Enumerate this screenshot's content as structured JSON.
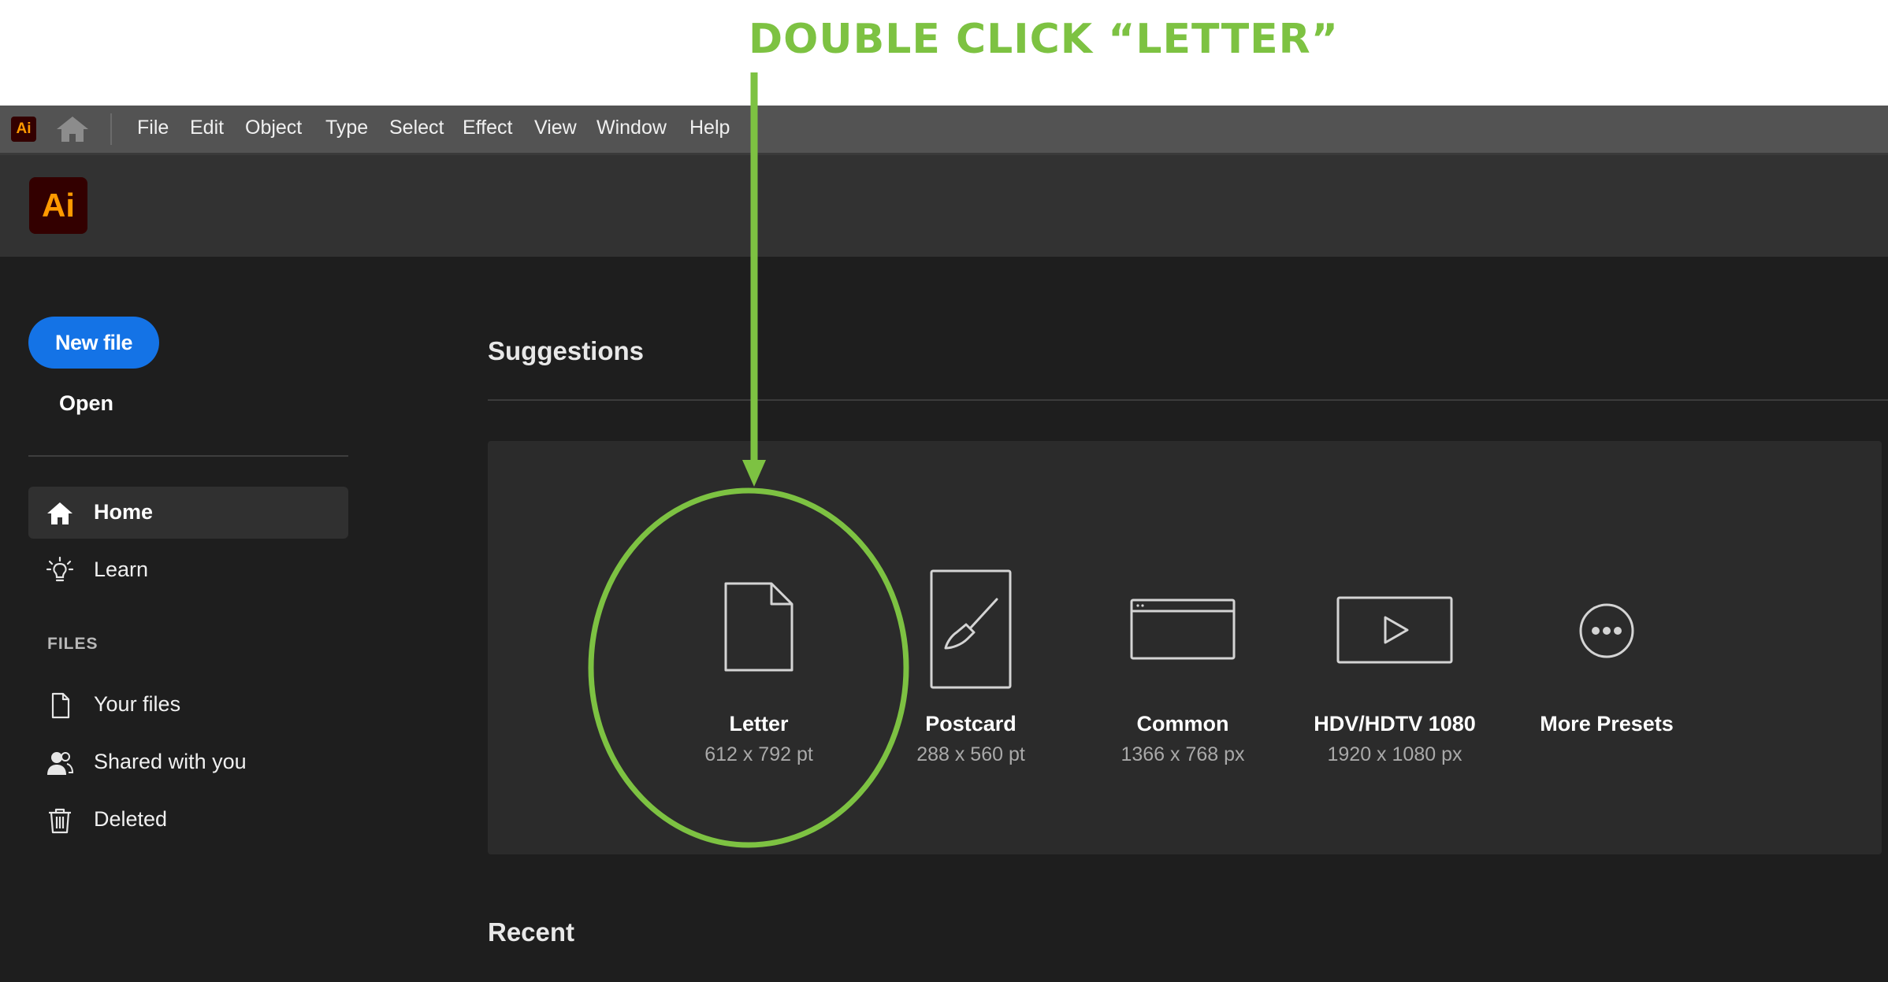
{
  "annotation": {
    "instruction": "DOUBLE CLICK “LETTER”",
    "color": "#7dc242"
  },
  "menubar": {
    "app_badge": "Ai",
    "items": [
      "File",
      "Edit",
      "Object",
      "Type",
      "Select",
      "Effect",
      "View",
      "Window",
      "Help"
    ]
  },
  "header": {
    "logo_text": "Ai",
    "logo_color": "#ff9a00"
  },
  "sidebar": {
    "new_file_label": "New file",
    "new_file_color": "#1473e6",
    "open_label": "Open",
    "nav": [
      {
        "label": "Home",
        "icon": "home-icon",
        "active": true
      },
      {
        "label": "Learn",
        "icon": "lightbulb-icon",
        "active": false
      }
    ],
    "files_heading": "FILES",
    "files": [
      {
        "label": "Your files",
        "icon": "document-icon"
      },
      {
        "label": "Shared with you",
        "icon": "people-icon"
      },
      {
        "label": "Deleted",
        "icon": "trash-icon"
      }
    ]
  },
  "main": {
    "suggestions_title": "Suggestions",
    "presets": [
      {
        "name": "Letter",
        "size": "612 x 792 pt",
        "icon": "letter-page-icon"
      },
      {
        "name": "Postcard",
        "size": "288 x 560 pt",
        "icon": "postcard-brush-icon"
      },
      {
        "name": "Common",
        "size": "1366 x 768 px",
        "icon": "browser-window-icon"
      },
      {
        "name": "HDV/HDTV 1080",
        "size": "1920 x 1080 px",
        "icon": "video-play-icon"
      },
      {
        "name": "More Presets",
        "size": "",
        "icon": "more-ellipsis-icon"
      }
    ],
    "recent_title": "Recent"
  }
}
